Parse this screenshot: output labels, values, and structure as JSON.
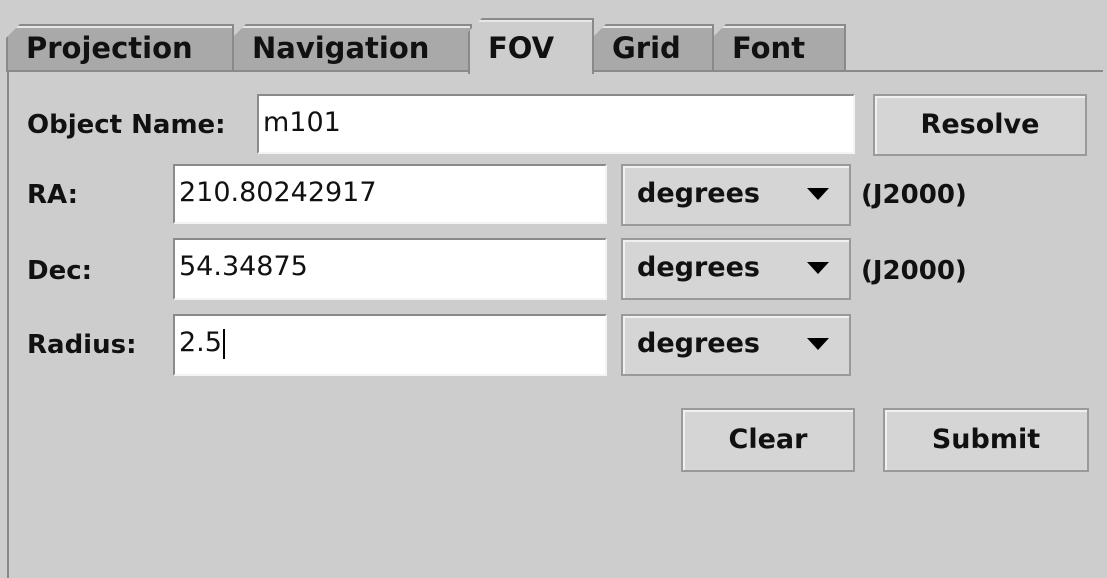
{
  "tabs": [
    {
      "label": "Projection"
    },
    {
      "label": "Navigation"
    },
    {
      "label": "FOV",
      "active": true
    },
    {
      "label": "Grid"
    },
    {
      "label": "Font"
    }
  ],
  "form": {
    "object_name": {
      "label": "Object Name:",
      "value": "m101",
      "resolve_label": "Resolve"
    },
    "ra": {
      "label": "RA:",
      "value": "210.80242917",
      "unit": "degrees",
      "epoch": "(J2000)"
    },
    "dec": {
      "label": "Dec:",
      "value": "54.34875",
      "unit": "degrees",
      "epoch": "(J2000)"
    },
    "radius": {
      "label": "Radius:",
      "value": "2.5",
      "unit": "degrees"
    }
  },
  "buttons": {
    "clear": "Clear",
    "submit": "Submit"
  }
}
